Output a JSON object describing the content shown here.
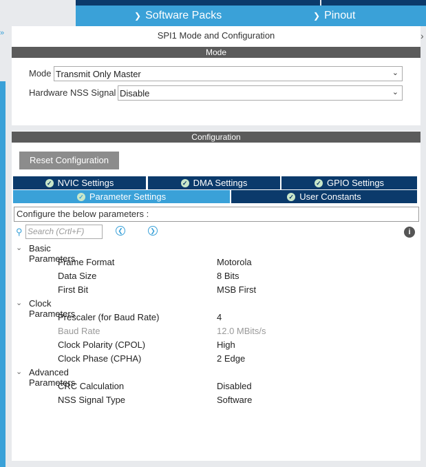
{
  "nav": {
    "software_packs": "Software Packs",
    "pinout": "Pinout"
  },
  "panel": {
    "title": "SPI1 Mode and Configuration",
    "mode_header": "Mode",
    "config_header": "Configuration"
  },
  "mode": {
    "mode_label": "Mode",
    "mode_value": "Transmit Only Master",
    "nss_label": "Hardware NSS Signal",
    "nss_value": "Disable"
  },
  "config": {
    "reset_label": "Reset Configuration",
    "tabs": {
      "nvic": "NVIC Settings",
      "dma": "DMA Settings",
      "gpio": "GPIO Settings",
      "parameter": "Parameter Settings",
      "user_constants": "User Constants"
    },
    "info_text": "Configure the below parameters :",
    "search_placeholder": "Search (Crtl+F)"
  },
  "params": {
    "basic": {
      "name": "Basic Parameters",
      "frame_format": {
        "name": "Frame Format",
        "value": "Motorola"
      },
      "data_size": {
        "name": "Data Size",
        "value": "8 Bits"
      },
      "first_bit": {
        "name": "First Bit",
        "value": "MSB First"
      }
    },
    "clock": {
      "name": "Clock Parameters",
      "prescaler": {
        "name": "Prescaler (for Baud Rate)",
        "value": "4"
      },
      "baud_rate": {
        "name": "Baud Rate",
        "value": "12.0 MBits/s"
      },
      "cpol": {
        "name": "Clock Polarity (CPOL)",
        "value": "High"
      },
      "cpha": {
        "name": "Clock Phase (CPHA)",
        "value": "2 Edge"
      }
    },
    "advanced": {
      "name": "Advanced Parameters",
      "crc": {
        "name": "CRC Calculation",
        "value": "Disabled"
      },
      "nss_type": {
        "name": "NSS Signal Type",
        "value": "Software"
      }
    }
  },
  "colors": {
    "nav_blue": "#3aa1d8",
    "dark_navy": "#0b3a6b",
    "section_gray": "#5b5b5b"
  }
}
